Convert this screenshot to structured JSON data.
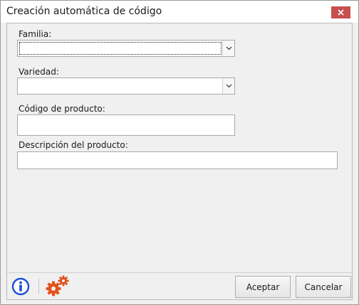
{
  "window": {
    "title": "Creación automática de código"
  },
  "form": {
    "familia_label": "Familia:",
    "familia_value": "",
    "variedad_label": "Variedad:",
    "variedad_value": "",
    "codigo_label": "Código de producto:",
    "codigo_value": "",
    "descripcion_label": "Descripción del producto:",
    "descripcion_value": ""
  },
  "footer": {
    "info_icon": "info-icon",
    "settings_icon": "gears-icon",
    "accept_label": "Aceptar",
    "cancel_label": "Cancelar"
  },
  "colors": {
    "close_button": "#c7504f",
    "info_icon": "#1a4fd6",
    "gears_icon": "#e2521c"
  }
}
